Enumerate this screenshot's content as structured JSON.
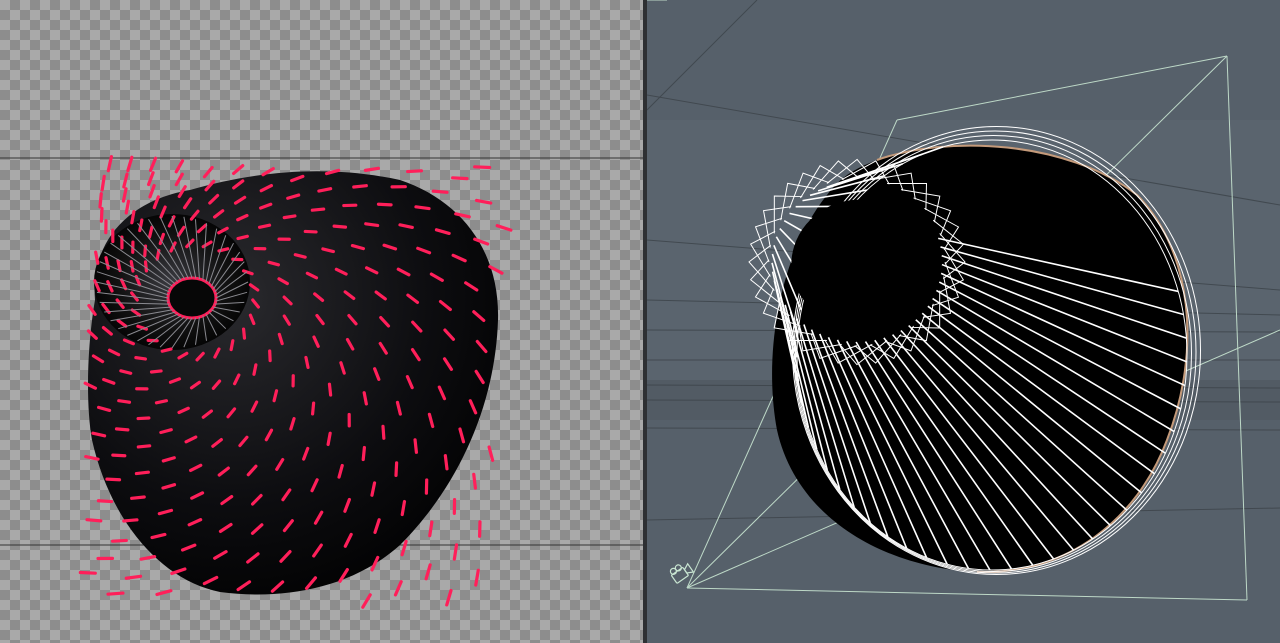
{
  "colors": {
    "accent": "#ff1f5a",
    "object_body": "#0a0a0c",
    "checker_light": "#a9a9a9",
    "checker_dark": "#8d8d8d",
    "viewport_bg": "#56606a",
    "wireframe": "#ffffff",
    "camera_line": "#c9e6d2",
    "guide_line": "#2f3337"
  },
  "icons": {
    "camera": "camera-icon"
  }
}
